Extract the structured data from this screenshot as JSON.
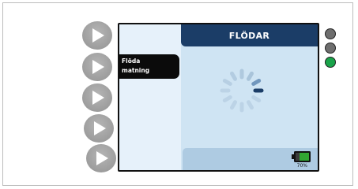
{
  "device": {
    "screen_title": "FLÖDAR",
    "menu_item": {
      "line1": "Flöda",
      "line2": "matning"
    },
    "battery": {
      "level_percent": 70,
      "label": "70%",
      "color": "#31a532"
    },
    "side_buttons": [
      {
        "icon": "play-icon"
      },
      {
        "icon": "play-icon"
      },
      {
        "icon": "play-icon"
      },
      {
        "icon": "play-icon"
      },
      {
        "icon": "play-icon"
      }
    ],
    "status_leds": [
      {
        "color": "#6e6e6e",
        "state": "off"
      },
      {
        "color": "#6e6e6e",
        "state": "off"
      },
      {
        "color": "#1aa34a",
        "state": "on"
      }
    ],
    "spinner": {
      "icon": "loading-spinner-icon"
    }
  }
}
